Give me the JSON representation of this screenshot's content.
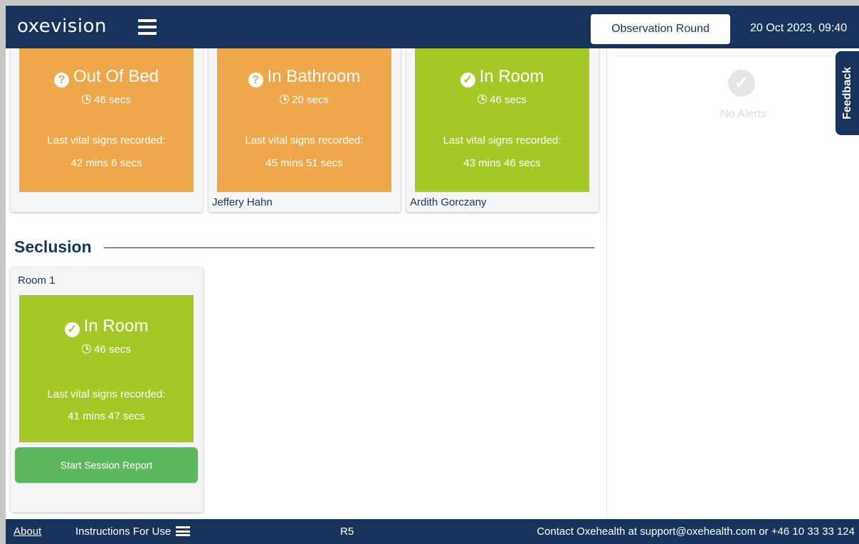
{
  "header": {
    "logo": "oxevision",
    "observation_button": "Observation Round",
    "datetime": "20 Oct 2023, 09:40"
  },
  "top_cards": [
    {
      "status": "Out Of Bed",
      "status_icon": "question-circle-icon",
      "status_color": "#eea84a",
      "time": "46 secs",
      "vital_label": "Last vital signs recorded:",
      "vital_value": "42 mins 6 secs",
      "patient": ""
    },
    {
      "status": "In Bathroom",
      "status_icon": "question-circle-icon",
      "status_color": "#eea84a",
      "time": "20 secs",
      "vital_label": "Last vital signs recorded:",
      "vital_value": "45 mins 51 secs",
      "patient": "Jeffery Hahn"
    },
    {
      "status": "In Room",
      "status_icon": "check-circle-icon",
      "status_color": "#a4c826",
      "time": "46 secs",
      "vital_label": "Last vital signs recorded:",
      "vital_value": "43 mins 46 secs",
      "patient": "Ardith Gorczany"
    }
  ],
  "section": {
    "title": "Seclusion"
  },
  "seclusion_card": {
    "room": "Room 1",
    "status": "In Room",
    "status_icon": "check-circle-icon",
    "status_color": "#a4c826",
    "time": "46 secs",
    "vital_label": "Last vital signs recorded:",
    "vital_value": "41 mins 47 secs",
    "button": "Start Session Report",
    "button_color": "#5cb85c"
  },
  "alerts": {
    "empty_text": "No Alerts",
    "feedback_label": "Feedback"
  },
  "footer": {
    "about": "About",
    "instructions": "Instructions For Use",
    "version": "R5",
    "contact": "Contact Oxehealth at support@oxehealth.com or +46 10 33 33 124"
  },
  "colors": {
    "navy": "#17355c",
    "amber": "#eea84a",
    "lime": "#a4c826",
    "green_button": "#5cb85c"
  }
}
